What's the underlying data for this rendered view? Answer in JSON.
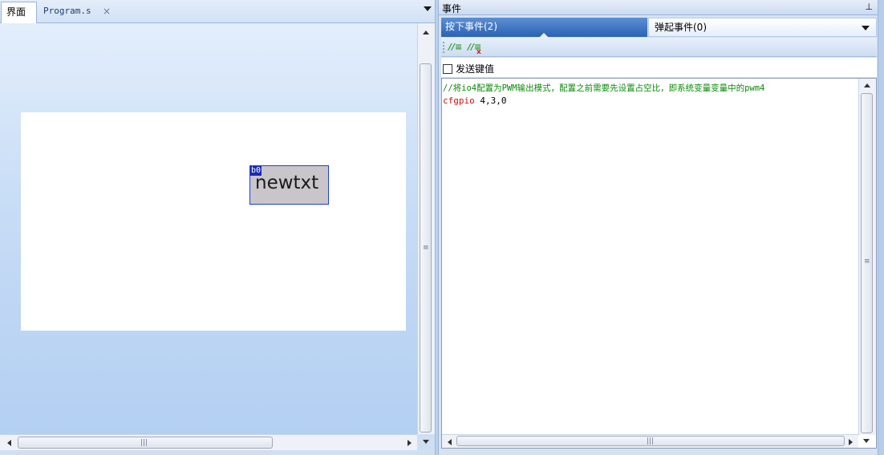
{
  "left_panel": {
    "tabs": [
      {
        "label": "界面",
        "active": true
      },
      {
        "label": "Program.s",
        "active": false,
        "close_glyph": "×"
      }
    ],
    "designer": {
      "widget": {
        "id_label": "b0",
        "text": "newtxt"
      }
    },
    "scroll": {
      "grip": "≡",
      "hgrip": "|||"
    }
  },
  "right_panel": {
    "title": "事件",
    "pin_glyph": "ᵖ",
    "event_tabs": [
      {
        "label": "按下事件(2)",
        "active": true
      },
      {
        "label": "弹起事件(0)",
        "active": false
      }
    ],
    "toolbar": {
      "comment_glyph": "//≡",
      "uncomment_glyph": "//≡",
      "uncomment_x": "x"
    },
    "send_key_value": {
      "label": "发送键值",
      "checked": false
    },
    "code": [
      {
        "type": "comment",
        "text": "//将io4配置为PWM输出模式，配置之前需要先设置占空比，即系统变量变量中的pwm4"
      },
      {
        "type": "command",
        "keyword": "cfgpio",
        "args": " 4,3,0"
      }
    ]
  },
  "colors": {
    "active_tab": "#2b62b4",
    "comment": "#0a8a0a",
    "keyword": "#d01010",
    "widget_bg": "#c8c6c8",
    "widget_border": "#1e3fd8"
  }
}
